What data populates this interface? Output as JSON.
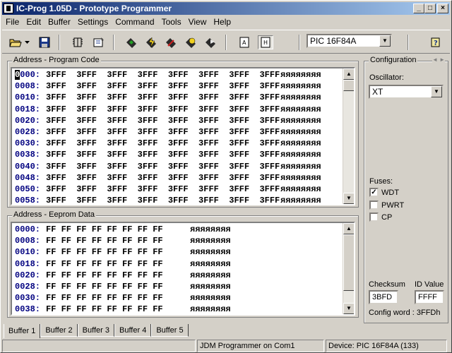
{
  "window": {
    "title": "IC-Prog 1.05D - Prototype Programmer",
    "minimize": "_",
    "maximize": "□",
    "close": "×"
  },
  "menu": [
    "File",
    "Edit",
    "Buffer",
    "Settings",
    "Command",
    "Tools",
    "View",
    "Help"
  ],
  "toolbar": {
    "device_value": "PIC 16F84A",
    "icons": [
      "open-folder-icon",
      "save-disk-icon",
      "device-info-icon",
      "config-icon",
      "read-chip-icon",
      "program-chip-icon",
      "erase-chip-icon",
      "verify-chip-icon",
      "blank-check-icon",
      "ascii-view-icon",
      "hex-view-icon",
      "help-icon"
    ]
  },
  "program": {
    "title": "Address - Program Code",
    "rows": [
      {
        "addr": "0000:",
        "cells": "3FFF  3FFF  3FFF  3FFF  3FFF  3FFF  3FFF  3FFF",
        "ascii": "яяяяяяяя"
      },
      {
        "addr": "0008:",
        "cells": "3FFF  3FFF  3FFF  3FFF  3FFF  3FFF  3FFF  3FFF",
        "ascii": "яяяяяяяя"
      },
      {
        "addr": "0010:",
        "cells": "3FFF  3FFF  3FFF  3FFF  3FFF  3FFF  3FFF  3FFF",
        "ascii": "яяяяяяяя"
      },
      {
        "addr": "0018:",
        "cells": "3FFF  3FFF  3FFF  3FFF  3FFF  3FFF  3FFF  3FFF",
        "ascii": "яяяяяяяя"
      },
      {
        "addr": "0020:",
        "cells": "3FFF  3FFF  3FFF  3FFF  3FFF  3FFF  3FFF  3FFF",
        "ascii": "яяяяяяяя"
      },
      {
        "addr": "0028:",
        "cells": "3FFF  3FFF  3FFF  3FFF  3FFF  3FFF  3FFF  3FFF",
        "ascii": "яяяяяяяя"
      },
      {
        "addr": "0030:",
        "cells": "3FFF  3FFF  3FFF  3FFF  3FFF  3FFF  3FFF  3FFF",
        "ascii": "яяяяяяяя"
      },
      {
        "addr": "0038:",
        "cells": "3FFF  3FFF  3FFF  3FFF  3FFF  3FFF  3FFF  3FFF",
        "ascii": "яяяяяяяя"
      },
      {
        "addr": "0040:",
        "cells": "3FFF  3FFF  3FFF  3FFF  3FFF  3FFF  3FFF  3FFF",
        "ascii": "яяяяяяяя"
      },
      {
        "addr": "0048:",
        "cells": "3FFF  3FFF  3FFF  3FFF  3FFF  3FFF  3FFF  3FFF",
        "ascii": "яяяяяяяя"
      },
      {
        "addr": "0050:",
        "cells": "3FFF  3FFF  3FFF  3FFF  3FFF  3FFF  3FFF  3FFF",
        "ascii": "яяяяяяяя"
      },
      {
        "addr": "0058:",
        "cells": "3FFF  3FFF  3FFF  3FFF  3FFF  3FFF  3FFF  3FFF",
        "ascii": "яяяяяяяя"
      }
    ]
  },
  "eeprom": {
    "title": "Address - Eeprom Data",
    "rows": [
      {
        "addr": "0000:",
        "cells": "FF FF FF FF FF FF FF FF",
        "ascii": "яяяяяяяя"
      },
      {
        "addr": "0008:",
        "cells": "FF FF FF FF FF FF FF FF",
        "ascii": "яяяяяяяя"
      },
      {
        "addr": "0010:",
        "cells": "FF FF FF FF FF FF FF FF",
        "ascii": "яяяяяяяя"
      },
      {
        "addr": "0018:",
        "cells": "FF FF FF FF FF FF FF FF",
        "ascii": "яяяяяяяя"
      },
      {
        "addr": "0020:",
        "cells": "FF FF FF FF FF FF FF FF",
        "ascii": "яяяяяяяя"
      },
      {
        "addr": "0028:",
        "cells": "FF FF FF FF FF FF FF FF",
        "ascii": "яяяяяяяя"
      },
      {
        "addr": "0030:",
        "cells": "FF FF FF FF FF FF FF FF",
        "ascii": "яяяяяяяя"
      },
      {
        "addr": "0038:",
        "cells": "FF FF FF FF FF FF FF FF",
        "ascii": "яяяяяяяя"
      }
    ]
  },
  "config": {
    "title": "Configuration",
    "oscillator_label": "Oscillator:",
    "oscillator_value": "XT",
    "fuses_label": "Fuses:",
    "fuses": [
      {
        "name": "WDT",
        "checked": true,
        "mark": "✓"
      },
      {
        "name": "PWRT",
        "checked": false,
        "mark": ""
      },
      {
        "name": "CP",
        "checked": false,
        "mark": ""
      }
    ],
    "checksum_label": "Checksum",
    "checksum_value": "3BFD",
    "id_label": "ID Value",
    "id_value": "FFFF",
    "config_word": "Config word : 3FFDh"
  },
  "tabs": [
    "Buffer 1",
    "Buffer 2",
    "Buffer 3",
    "Buffer 4",
    "Buffer 5"
  ],
  "status": {
    "programmer": "JDM Programmer on Com1",
    "device": "Device: PIC 16F84A  (133)"
  }
}
